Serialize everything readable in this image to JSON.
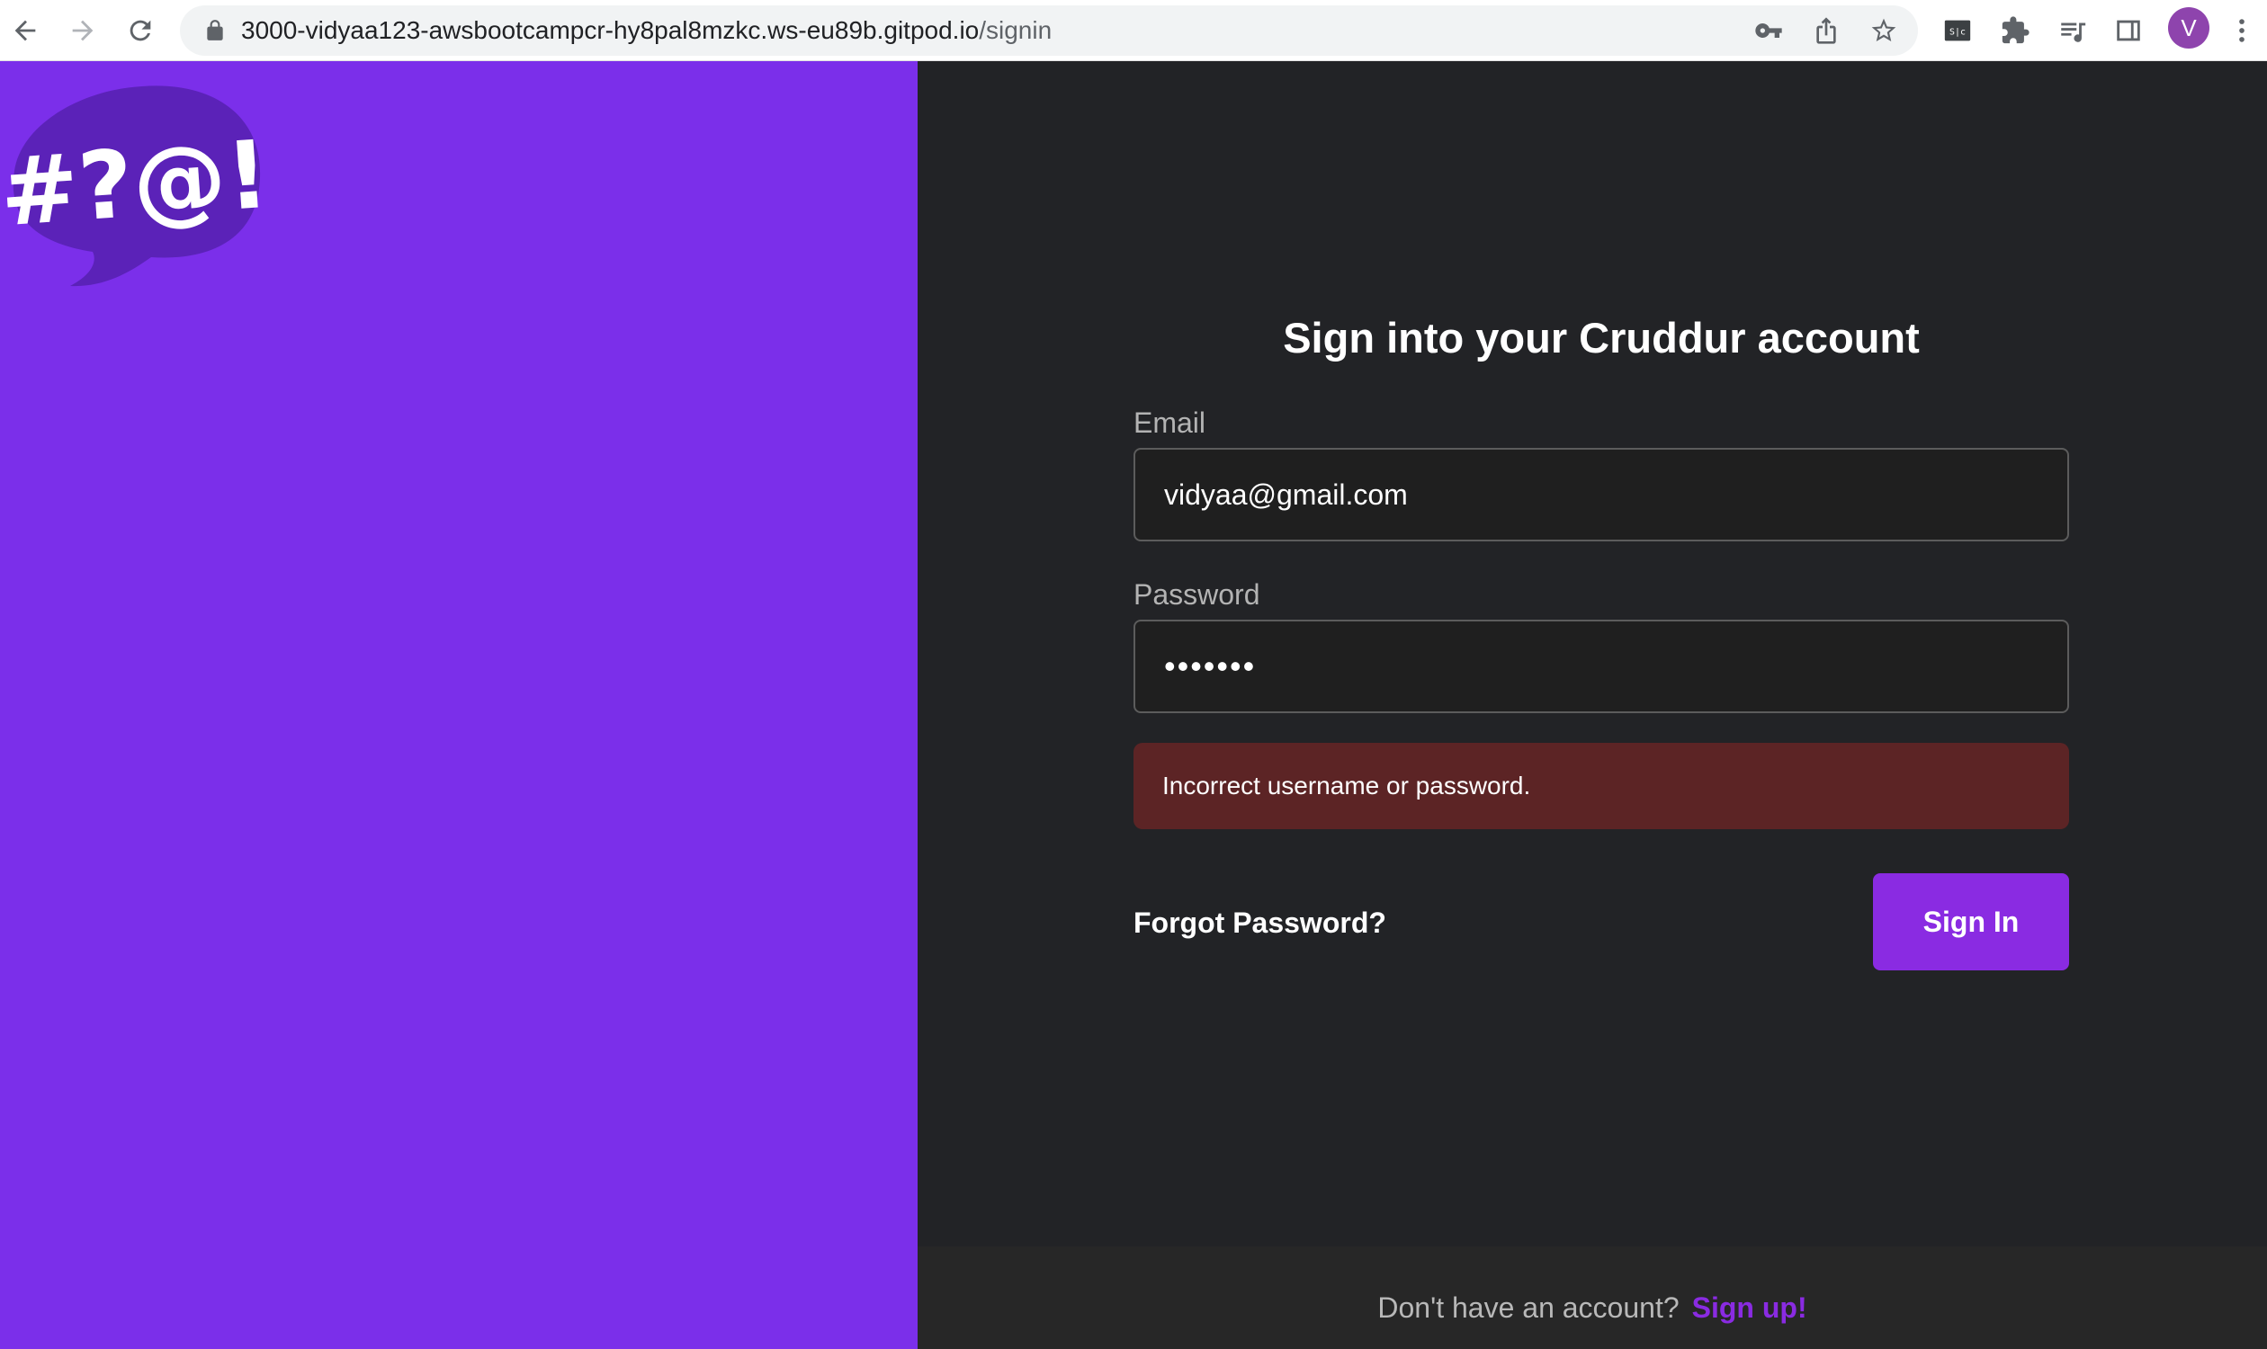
{
  "browser": {
    "url_host": "3000-vidyaa123-awsbootcampcr-hy8pal8mzkc.ws-eu89b.gitpod.io",
    "url_path": "/signin",
    "avatar_letter": "V",
    "extension_icons": [
      "extension-icon",
      "puzzle-icon",
      "reading-list-icon",
      "side-panel-icon"
    ]
  },
  "logo": {
    "text": "#?@!",
    "bubble_color": "#5b22b8"
  },
  "signin": {
    "title": "Sign into your Cruddur account",
    "email_label": "Email",
    "email_value": "vidyaa@gmail.com",
    "password_label": "Password",
    "password_value": "•••••••",
    "error_message": "Incorrect username or password.",
    "forgot_label": "Forgot Password?",
    "submit_label": "Sign In"
  },
  "footer": {
    "prompt": "Don't have an account?",
    "signup_label": "Sign up!"
  },
  "colors": {
    "accent": "#8a2be2",
    "left_panel": "#7b2fea",
    "right_panel": "#222326",
    "error_bg": "#5c2425"
  }
}
